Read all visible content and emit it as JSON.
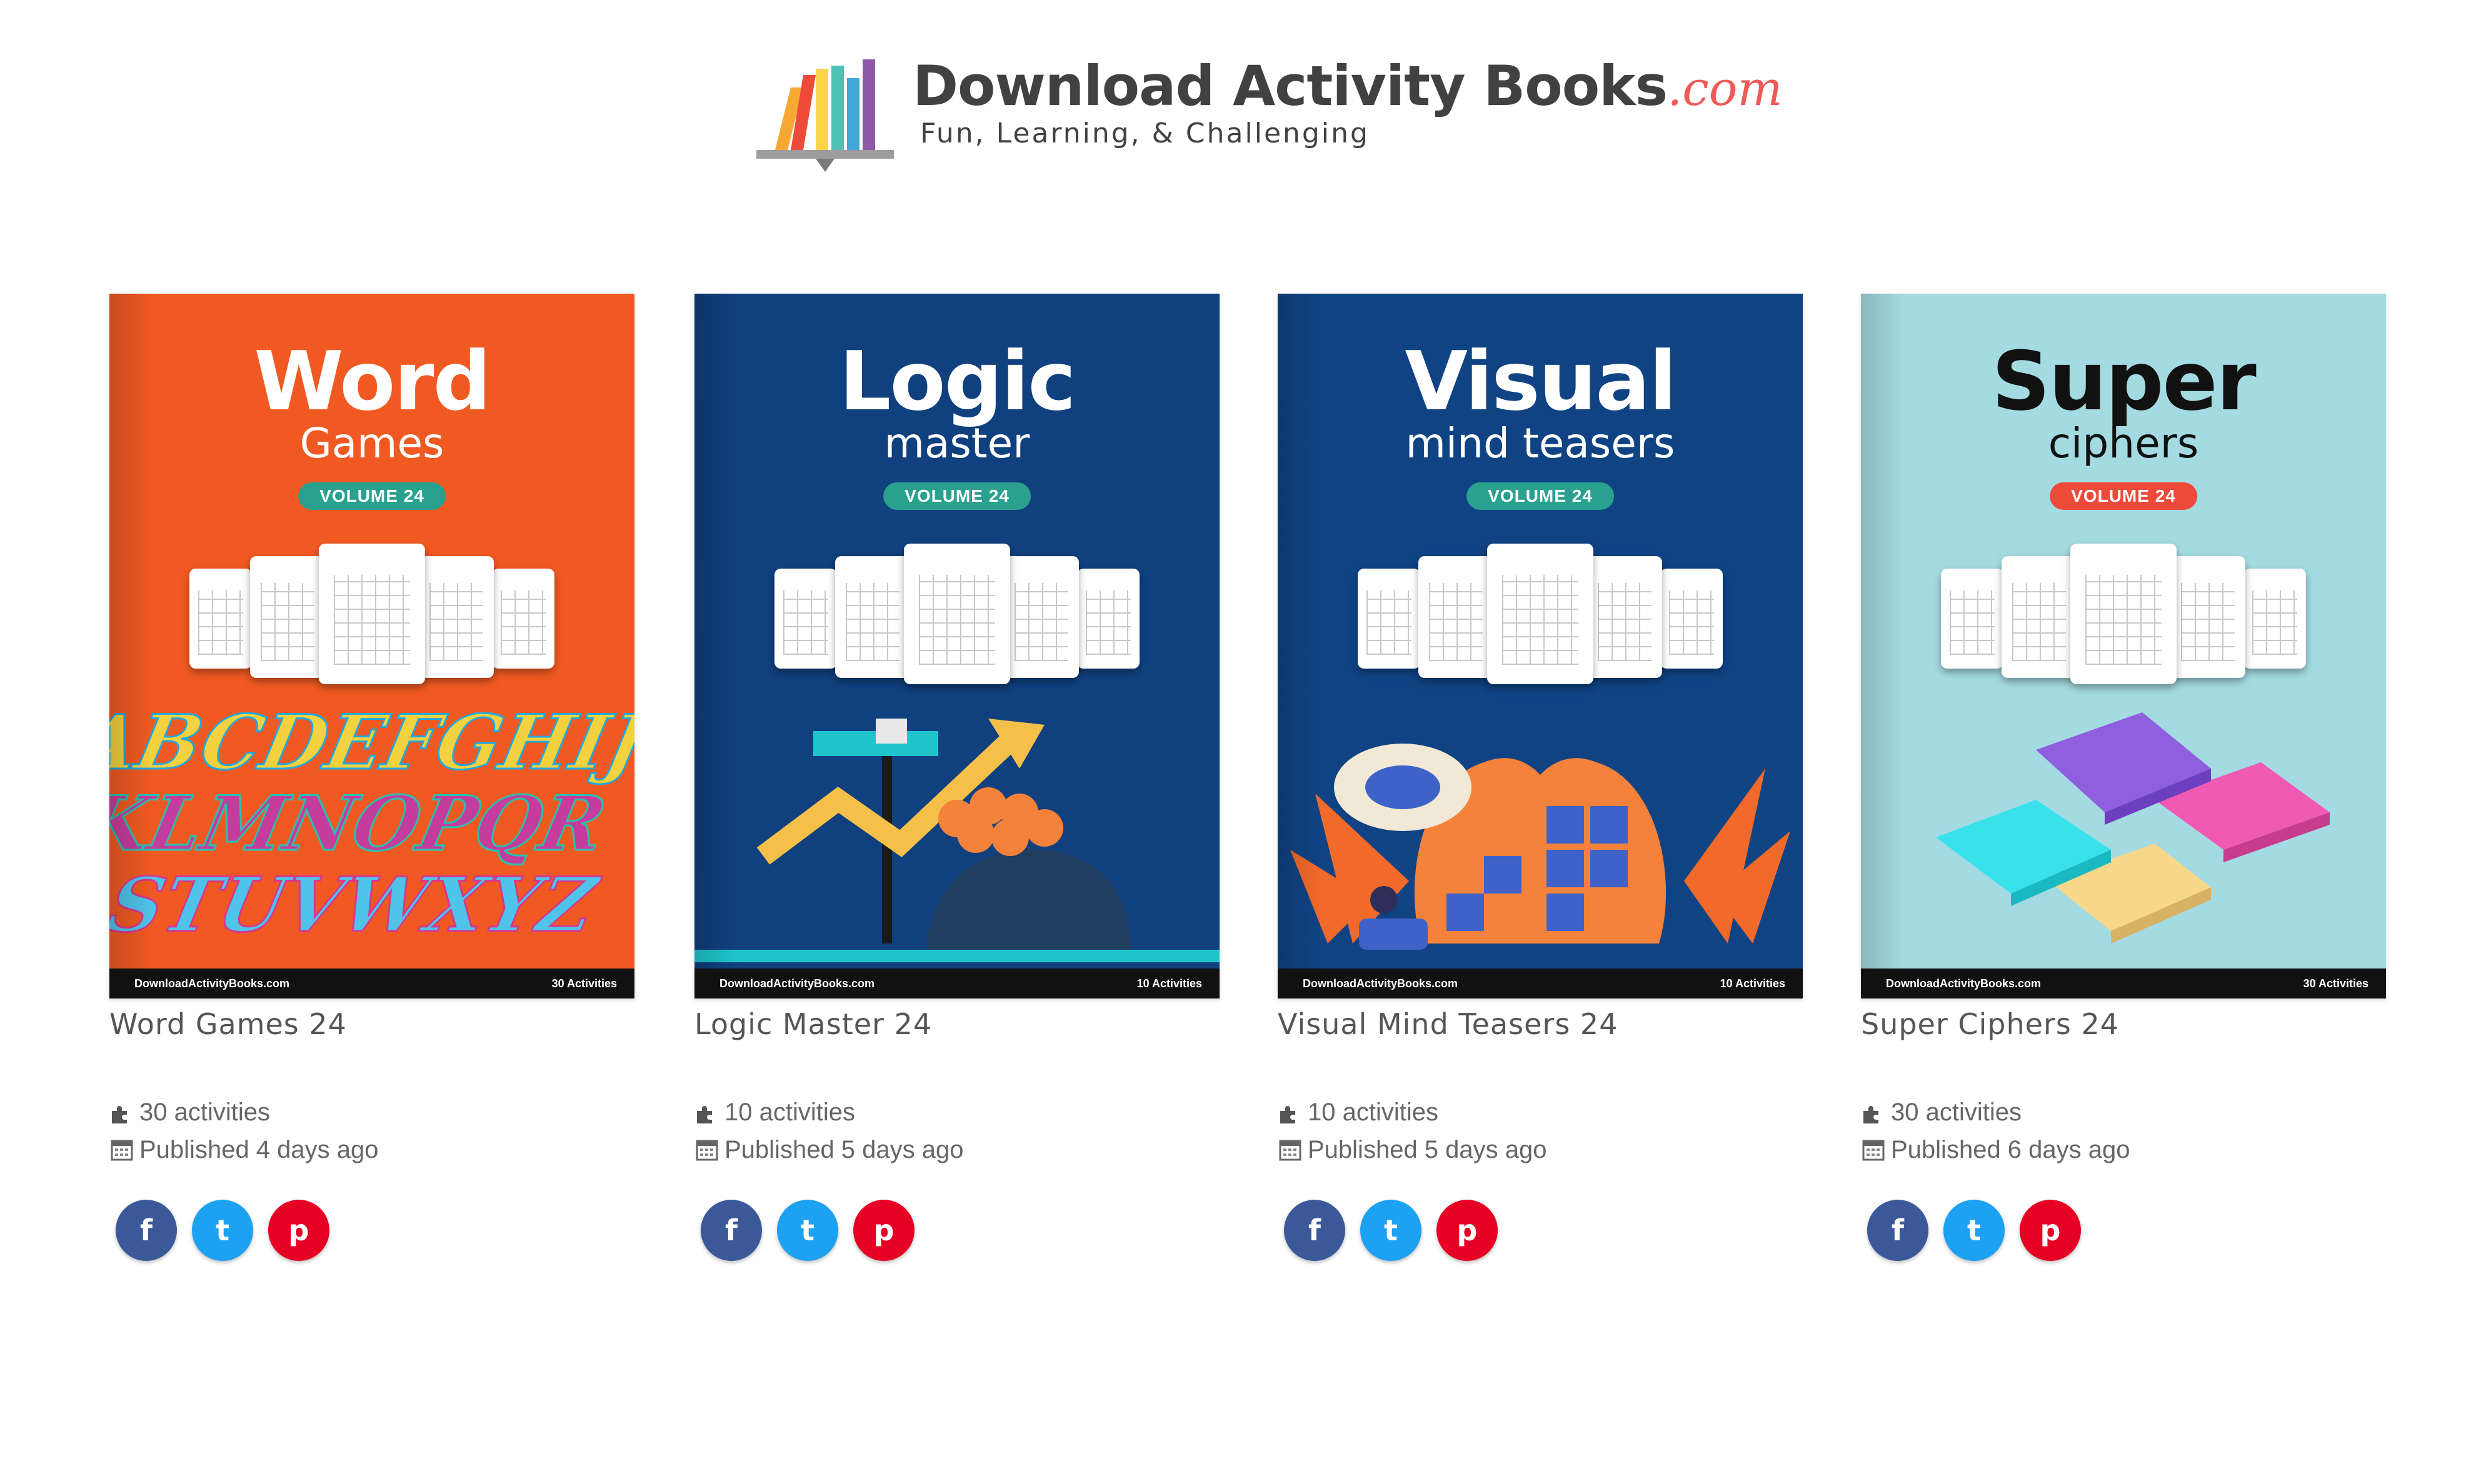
{
  "site": {
    "logo_title": "Download Activity Books",
    "logo_com": ".com",
    "tagline": "Fun, Learning, & Challenging"
  },
  "books": [
    {
      "title": "Word Games 24",
      "cover_title": "Word",
      "cover_sub": "Games",
      "volume": "VOLUME 24",
      "cover_bg": "#f05a22",
      "title_color": "#ffffff",
      "pill_color": "#2aa18f",
      "footer_left": "DownloadActivityBooks.com",
      "footer_right": "30 Activities",
      "activities": "30 activities",
      "published": "Published 4 days ago"
    },
    {
      "title": "Logic Master 24",
      "cover_title": "Logic",
      "cover_sub": "master",
      "volume": "VOLUME 24",
      "cover_bg": "#10407e",
      "title_color": "#ffffff",
      "pill_color": "#2aa18f",
      "footer_left": "DownloadActivityBooks.com",
      "footer_right": "10 Activities",
      "activities": "10 activities",
      "published": "Published 5 days ago"
    },
    {
      "title": "Visual Mind Teasers 24",
      "cover_title": "Visual",
      "cover_sub": "mind teasers",
      "volume": "VOLUME 24",
      "cover_bg": "#0f4384",
      "title_color": "#ffffff",
      "pill_color": "#2aa18f",
      "footer_left": "DownloadActivityBooks.com",
      "footer_right": "10 Activities",
      "activities": "10 activities",
      "published": "Published 5 days ago"
    },
    {
      "title": "Super Ciphers 24",
      "cover_title": "Super",
      "cover_sub": "ciphers",
      "volume": "VOLUME 24",
      "cover_bg": "#a4dbe2",
      "title_color": "#111111",
      "pill_color": "#ee4a3a",
      "footer_left": "DownloadActivityBooks.com",
      "footer_right": "30 Activities",
      "activities": "30 activities",
      "published": "Published 6 days ago"
    }
  ],
  "share": {
    "facebook_icon": "f",
    "twitter_icon": "t",
    "pinterest_icon": "p",
    "facebook_color": "#3b5998",
    "twitter_color": "#1da1f2",
    "pinterest_color": "#e60023"
  }
}
